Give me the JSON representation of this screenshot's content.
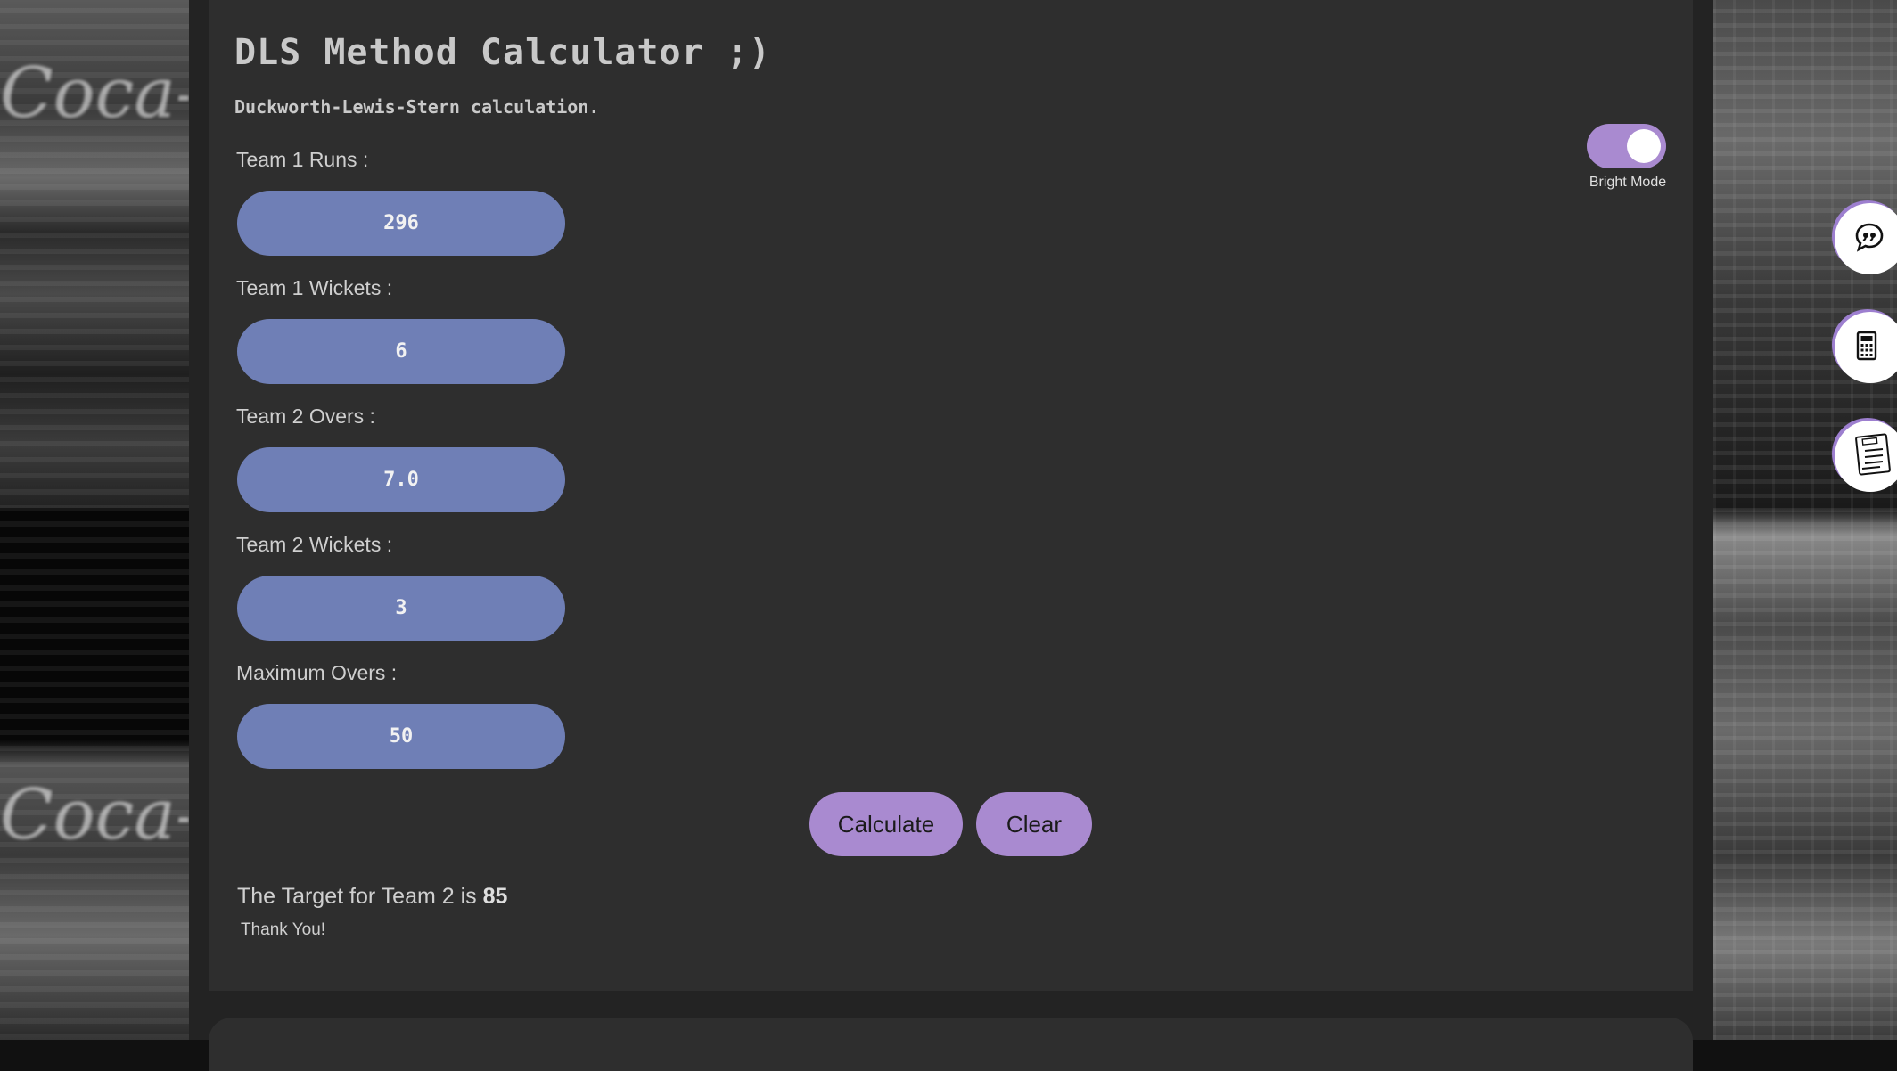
{
  "app": {
    "title": "DLS Method Calculator ;)",
    "subtitle": "Duckworth-Lewis-Stern calculation."
  },
  "form": {
    "fields": [
      {
        "label": "Team 1 Runs :",
        "value": "296"
      },
      {
        "label": "Team 1 Wickets :",
        "value": "6"
      },
      {
        "label": "Team 2 Overs :",
        "value": "7.0"
      },
      {
        "label": "Team 2 Wickets :",
        "value": "3"
      },
      {
        "label": "Maximum Overs :",
        "value": "50"
      }
    ]
  },
  "buttons": {
    "calculate": "Calculate",
    "clear": "Clear"
  },
  "result": {
    "prefix": "The Target for Team 2 is",
    "target": "85",
    "thanks": "Thank You!"
  },
  "theme_toggle": {
    "label": "Bright Mode",
    "on": true
  },
  "side_nav": {
    "icons": [
      "quote-chat-icon",
      "calculator-icon",
      "plan-list-icon"
    ]
  },
  "colors": {
    "accent": "#a98ad0",
    "input": "#6f7fb6",
    "card": "#2e2e2e"
  }
}
